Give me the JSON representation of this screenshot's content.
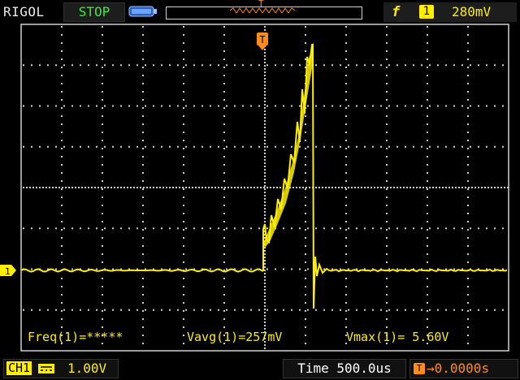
{
  "header": {
    "brand": "RIGOL",
    "run_state": "STOP",
    "trigger": {
      "source": "1",
      "level": "280mV",
      "edge_icon": "rising-edge-icon",
      "color": "#ffee00"
    }
  },
  "channel": {
    "name": "CH1",
    "scale": "1.00V",
    "marker": "1",
    "coupling_icon": "dc-coupling-icon",
    "color": "#ffee00"
  },
  "timebase": {
    "label": "Time",
    "value": "500.0us"
  },
  "trigger_offset": {
    "icon": "T",
    "value": "0.0000s",
    "color": "#ff8c1a"
  },
  "measurements": [
    {
      "label": "Freq(1)=",
      "value": "*****"
    },
    {
      "label": "Vavg(1)=",
      "value": "257mV"
    },
    {
      "label": "Vmax(1)=",
      "value": "5.60V"
    }
  ],
  "colors": {
    "trace": "#ffee00",
    "grid": "#cfcfcf",
    "trigger": "#ff8c1a",
    "status": "#33ee33"
  }
}
